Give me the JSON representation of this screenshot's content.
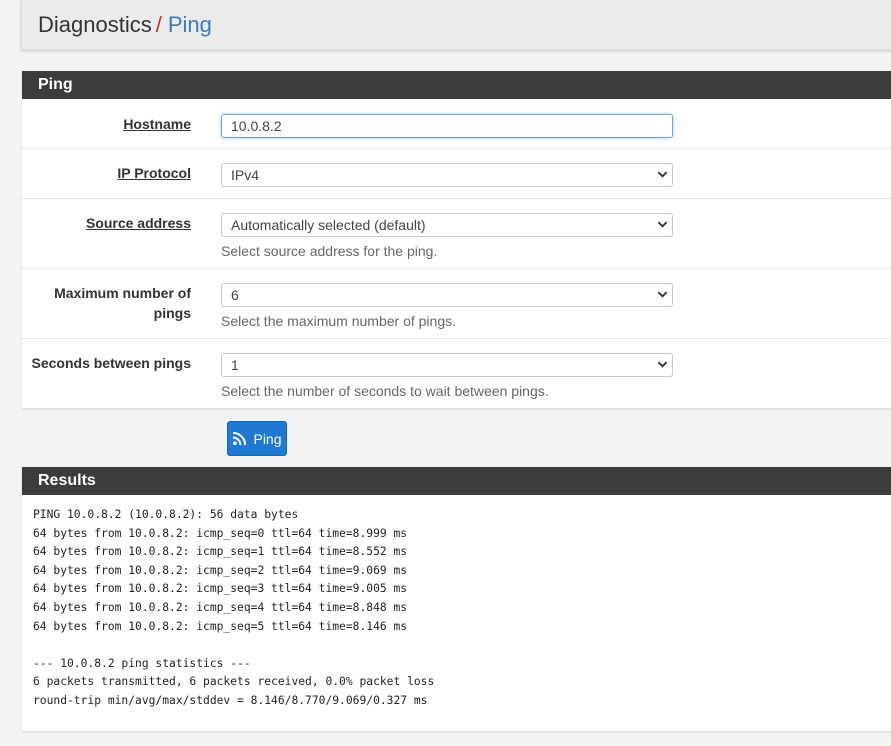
{
  "breadcrumb": {
    "first": "Diagnostics",
    "separator": "/",
    "second": "Ping"
  },
  "ping_panel": {
    "title": "Ping",
    "hostname": {
      "label": "Hostname",
      "value": "10.0.8.2"
    },
    "ip_protocol": {
      "label": "IP Protocol",
      "value": "IPv4"
    },
    "source_address": {
      "label": "Source address",
      "value": "Automatically selected (default)",
      "help": "Select source address for the ping."
    },
    "max_pings": {
      "label_line1": "Maximum number of",
      "label_line2": "pings",
      "value": "6",
      "help": "Select the maximum number of pings."
    },
    "seconds_between": {
      "label": "Seconds between pings",
      "value": "1",
      "help": "Select the number of seconds to wait between pings."
    }
  },
  "ping_button": {
    "label": "Ping",
    "icon": "rss-icon",
    "color": "#1f78d1"
  },
  "results": {
    "title": "Results",
    "lines": [
      "PING 10.0.8.2 (10.0.8.2): 56 data bytes",
      "64 bytes from 10.0.8.2: icmp_seq=0 ttl=64 time=8.999 ms",
      "64 bytes from 10.0.8.2: icmp_seq=1 ttl=64 time=8.552 ms",
      "64 bytes from 10.0.8.2: icmp_seq=2 ttl=64 time=9.069 ms",
      "64 bytes from 10.0.8.2: icmp_seq=3 ttl=64 time=9.005 ms",
      "64 bytes from 10.0.8.2: icmp_seq=4 ttl=64 time=8.848 ms",
      "64 bytes from 10.0.8.2: icmp_seq=5 ttl=64 time=8.146 ms",
      "",
      "--- 10.0.8.2 ping statistics ---",
      "6 packets transmitted, 6 packets received, 0.0% packet loss",
      "round-trip min/avg/max/stddev = 8.146/8.770/9.069/0.327 ms"
    ]
  },
  "colors": {
    "panel_header": "#3c3c3c",
    "breadcrumb_separator": "#c0392b",
    "breadcrumb_link": "#3a7dbf"
  }
}
